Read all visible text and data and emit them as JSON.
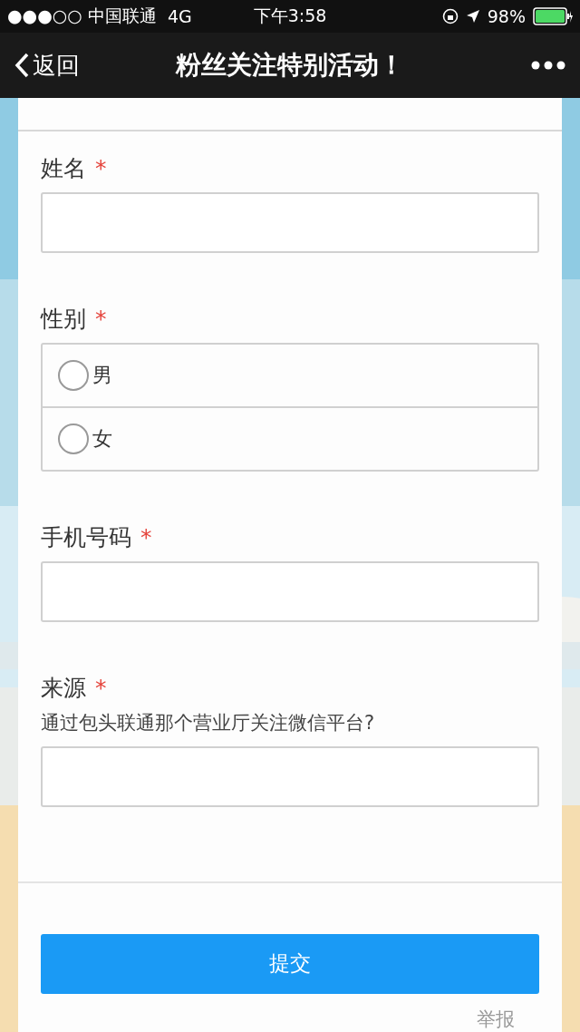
{
  "status_bar": {
    "carrier": "●●●○○ 中国联通",
    "network": "4G",
    "time": "下午3:58",
    "battery": "98%"
  },
  "nav": {
    "back": "返回",
    "title": "粉丝关注特别活动！"
  },
  "form": {
    "fields": [
      {
        "kind": "text",
        "label": "姓名",
        "required_mark": "*"
      },
      {
        "kind": "radio",
        "label": "性别",
        "required_mark": "*",
        "options": [
          {
            "label": "男",
            "selected": false
          },
          {
            "label": "女",
            "selected": false
          }
        ]
      },
      {
        "kind": "text",
        "label": "手机号码",
        "required_mark": "*"
      },
      {
        "kind": "text",
        "label": "来源",
        "required_mark": "*",
        "description": "通过包头联通那个营业厅关注微信平台?"
      }
    ],
    "submit": "提交",
    "report": "举报"
  }
}
